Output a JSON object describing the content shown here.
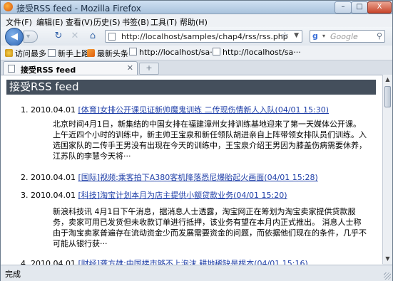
{
  "window": {
    "title": "接受RSS feed - Mozilla Firefox",
    "controls": [
      "–",
      "□",
      "X"
    ]
  },
  "menu": [
    "文件(F)",
    "编辑(E)",
    "查看(V)",
    "历史(S)",
    "书签(B)",
    "工具(T)",
    "帮助(H)"
  ],
  "nav": {
    "url": "http://localhost/samples/chap4/rss/rss.php",
    "search_engine": "Google",
    "search_placeholder": "Google"
  },
  "bookmarks": [
    {
      "label": "访问最多",
      "icon": "star-icon"
    },
    {
      "label": "新手上路",
      "icon": "bookmark-icon"
    },
    {
      "label": "最新头条",
      "icon": "rss-icon"
    },
    {
      "label": "http://localhost/sa···",
      "icon": "page-icon"
    },
    {
      "label": "http://localhost/sa···",
      "icon": "page-icon"
    }
  ],
  "tab": {
    "label": "接受RSS feed",
    "close": "✕",
    "new": "+"
  },
  "page": {
    "heading": "接受RSS feed",
    "items": [
      {
        "num": "1.",
        "date": "2010.04.01",
        "link": "[体育]女排公开课见证新帅魔鬼训练 二传现伤情新人入队(04/01 15:30)",
        "desc": "北京时间4月1日，新集结的中国女排在福建漳州女排训练基地迎来了第一天媒体公开课。上午近四个小时的训练中，新主帅王宝泉和新任领队胡进亲自上阵带领女排队员们训练。入选国家队的二传手王男没有出现在今天的训练中，王宝泉介绍王男因为膝盖伤病需要休养，江苏队的李慧今天将···"
      },
      {
        "num": "2.",
        "date": "2010.04.01",
        "link": "[国际]视频:乘客拍下A380客机降落悉尼爆胎起火画面(04/01 15:28)",
        "desc": ""
      },
      {
        "num": "3.",
        "date": "2010.04.01",
        "link": "[科技]淘宝计划本月为店主提供小额贷款业务(04/01 15:20)",
        "desc": "新浪科技讯 4月1日下午消息，据消息人士透露，淘宝网正在筹划为淘宝卖家提供贷款服务，卖家可用已发货但未收款订单进行抵押，该业务有望在本月内正式推出。 消息人士称由于淘宝卖家普遍存在流动资金少而发展需要资金的问题，而依据他们现在的条件，几乎不可能从银行获···"
      },
      {
        "num": "4.",
        "date": "2010.04.01",
        "link": "[财经]龚方雄:中国楼市够不上泡沫 耕地稀缺是根本(04/01 15:16)",
        "desc": ""
      }
    ]
  },
  "status": "完成"
}
